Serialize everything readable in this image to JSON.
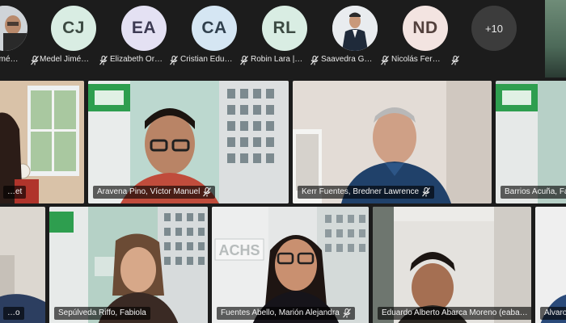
{
  "strip": {
    "participants": [
      {
        "initials": "",
        "name": "Amé…",
        "avatar_bg": "#cfd4d8",
        "avatar_fg": "#5a3c2a"
      },
      {
        "initials": "CJ",
        "name": "Medel Jimé…",
        "avatar_bg": "#d9ede3",
        "avatar_fg": "#3c4a42"
      },
      {
        "initials": "EA",
        "name": "Elizabeth Or…",
        "avatar_bg": "#e4e1f3",
        "avatar_fg": "#3c3a52"
      },
      {
        "initials": "CA",
        "name": "Cristian Edu…",
        "avatar_bg": "#d5e6f3",
        "avatar_fg": "#30404e"
      },
      {
        "initials": "RL",
        "name": "Robin Lara |…",
        "avatar_bg": "#d9ede3",
        "avatar_fg": "#3c4a42"
      },
      {
        "initials": "",
        "name": "Saavedra G…",
        "avatar_bg": "#e9ecef",
        "avatar_fg": "#333333"
      },
      {
        "initials": "ND",
        "name": "Nicolás Fer…",
        "avatar_bg": "#f3e4e1",
        "avatar_fg": "#52403c"
      }
    ],
    "more_count": "+10"
  },
  "tiles": [
    {
      "label": "…et",
      "active": true
    },
    {
      "label": "Aravena Pino, Víctor Manuel",
      "active": false
    },
    {
      "label": "Kerr Fuentes, Bredner Lawrence",
      "active": false
    },
    {
      "label": "Barrios Acuña, Fab…",
      "active": false
    },
    {
      "label": "…o",
      "active": false
    },
    {
      "label": "Sepúlveda Riffo, Fabiola",
      "active": true
    },
    {
      "label": "Fuentes Abello, Marión Alejandra",
      "active": false
    },
    {
      "label": "Eduardo Alberto Abarca Moreno (eaba…",
      "active": false
    },
    {
      "label": "Alvaro…",
      "active": false
    }
  ],
  "brand": {
    "sign_text": "ACHS",
    "accent": "#2e9e4f"
  },
  "colors": {
    "active_border": "#8f8fe3",
    "mic_muted": "#e8e8e8"
  },
  "icons": {
    "mic": "mic-muted-icon"
  }
}
